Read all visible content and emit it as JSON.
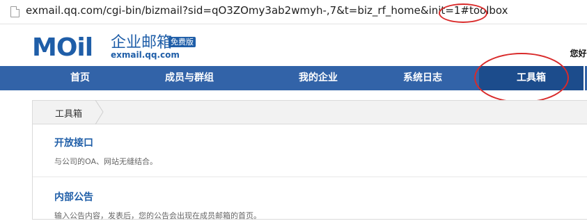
{
  "browser": {
    "url_main": "exmail.qq.com/cgi-bin/bizmail?sid=qO3ZOmy3ab2wmyh-,7&t=biz_rf_home&init=1#",
    "url_hash": "toolbox"
  },
  "header": {
    "logo_mark": "MOil",
    "logo_cn": "企业邮箱",
    "logo_badge": "免费版",
    "logo_url": "exmail.qq.com",
    "greeting": "您好,"
  },
  "nav": {
    "items": [
      {
        "label": "首页"
      },
      {
        "label": "成员与群组"
      },
      {
        "label": "我的企业"
      },
      {
        "label": "系统日志"
      },
      {
        "label": "工具箱"
      }
    ]
  },
  "breadcrumb": {
    "label": "工具箱"
  },
  "sections": [
    {
      "title": "开放接口",
      "desc": "与公司的OA、网站无缝结合。"
    },
    {
      "title": "内部公告",
      "desc": "输入公告内容，发表后，您的公告会出现在成员邮箱的首页。"
    }
  ],
  "colors": {
    "brand": "#1f5ea8",
    "nav_bg": "#3263a8",
    "nav_active": "#1c4c8c",
    "annotation": "#d92a2a"
  }
}
